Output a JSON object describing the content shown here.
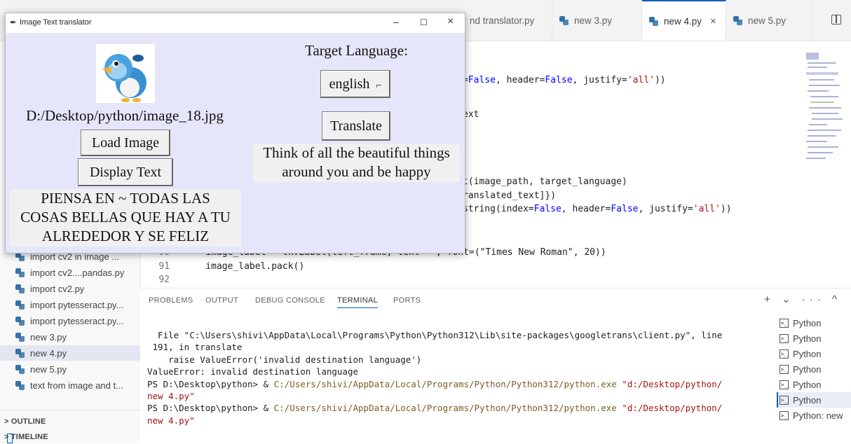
{
  "editor_tabs": [
    {
      "label": "nd translator.py",
      "active": false,
      "has_icon": false
    },
    {
      "label": "new 3.py",
      "active": false,
      "has_icon": true
    },
    {
      "label": "new 4.py",
      "active": true,
      "has_icon": true
    },
    {
      "label": "new 5.py",
      "active": false,
      "has_icon": true
    }
  ],
  "tab_close_glyph": "×",
  "code": {
    "line1_start": "=",
    "line1_kw1": "False",
    "line1_mid": ", header=",
    "line1_kw2": "False",
    "line1_mid2": ", justify=",
    "line1_str": "'all'",
    "line1_end": "))",
    "line2": "ext",
    "line3_a": "t(image_path, target_language)",
    "line4_a": "ranslated_text]})",
    "line5_a": "string(index=",
    "line5_kw1": "False",
    "line5_b": ", header=",
    "line5_kw2": "False",
    "line5_c": ", justify=",
    "line5_str": "'all'",
    "line5_d": "))",
    "line90_num": "90",
    "line90_text": "    image_label = tk.Label(left_frame, text=\"\", font=(\"Times New Roman\", 20))",
    "line91_num": "91",
    "line91_text": "    image_label.pack()",
    "line92_num": "92"
  },
  "sidebar": {
    "files": [
      {
        "label": "import cv2 in image ..."
      },
      {
        "label": "import cv2....pandas.py"
      },
      {
        "label": "import cv2.py"
      },
      {
        "label": "import pytesseract.py..."
      },
      {
        "label": "import pytesseract.py..."
      },
      {
        "label": "new 3.py"
      },
      {
        "label": "new 4.py",
        "selected": true
      },
      {
        "label": "new 5.py"
      },
      {
        "label": "text from image and t..."
      }
    ],
    "outline": "OUTLINE",
    "timeline": "TIMELINE",
    "chevron": ">"
  },
  "panel": {
    "tabs": [
      "PROBLEMS",
      "OUTPUT",
      "DEBUG CONSOLE",
      "TERMINAL",
      "PORTS"
    ],
    "active_tab": "TERMINAL",
    "actions": "+ ⌄ ··· ^",
    "terminal_lines": [
      "  File \"C:\\Users\\shivi\\AppData\\Local\\Programs\\Python\\Python312\\Lib\\site-packages\\googletrans\\client.py\", line",
      " 191, in translate",
      "    raise ValueError('invalid destination language')",
      "ValueError: invalid destination language"
    ],
    "ps_prompt": "PS D:\\Desktop\\python> & ",
    "ps_exe": "C:/Users/shivi/AppData/Local/Programs/Python/Python312/python.exe",
    "ps_arg1": "\"d:/Desktop/python/",
    "ps_arg2": "new 4.py\"",
    "terminals": [
      "Python",
      "Python",
      "Python",
      "Python",
      "Python",
      "Python",
      "Python: new"
    ],
    "selected_terminal_index": 5,
    "terminal_icon_glyph": ">_"
  },
  "tk_window": {
    "title": "Image Text translator",
    "minimize": "–",
    "maximize": "☐",
    "close": "×",
    "image_path": "D:/Desktop/python/image_18.jpg",
    "load_button": "Load Image",
    "display_button": "Display Text",
    "extracted_text_lines": [
      "PIENSA EN ~ TODAS LAS",
      "COSAS BELLAS QUE HAY A TU",
      "ALREDEDOR Y SE FELIZ"
    ],
    "target_language_label": "Target Language:",
    "language_value": "english",
    "dropdown_glyph": "⌐",
    "translate_button": "Translate",
    "translated_text_lines": [
      "Think of all the beautiful things",
      "around you and be happy"
    ]
  },
  "colors": {
    "accent": "#005fb8",
    "tk_background": "#e6e6fa",
    "keyword": "#0000ff",
    "string": "#a31515"
  }
}
